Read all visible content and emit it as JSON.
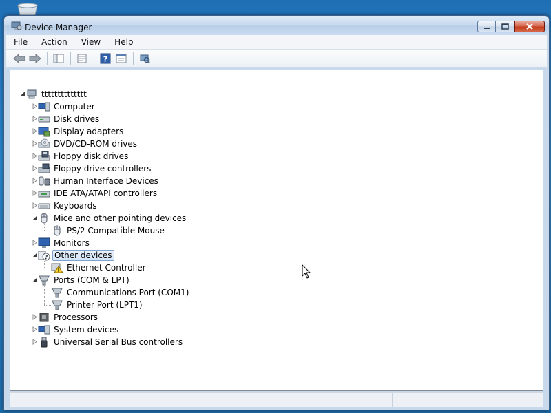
{
  "window": {
    "title": "Device Manager",
    "icon": "device-manager-icon"
  },
  "menu": [
    "File",
    "Action",
    "View",
    "Help"
  ],
  "toolbar": {
    "buttons": [
      "back-arrow-icon",
      "forward-arrow-icon",
      "show-hide-tree-icon",
      "properties-icon",
      "help-icon",
      "update-driver-icon",
      "scan-hardware-icon"
    ]
  },
  "tree": {
    "root": "tttttttttttttt",
    "nodes": [
      {
        "label": "Computer",
        "icon": "computer-icon",
        "expanded": false
      },
      {
        "label": "Disk drives",
        "icon": "disk-drive-icon",
        "expanded": false
      },
      {
        "label": "Display adapters",
        "icon": "display-adapter-icon",
        "expanded": false
      },
      {
        "label": "DVD/CD-ROM drives",
        "icon": "dvd-drive-icon",
        "expanded": false
      },
      {
        "label": "Floppy disk drives",
        "icon": "floppy-drive-icon",
        "expanded": false
      },
      {
        "label": "Floppy drive controllers",
        "icon": "floppy-controller-icon",
        "expanded": false
      },
      {
        "label": "Human Interface Devices",
        "icon": "hid-icon",
        "expanded": false
      },
      {
        "label": "IDE ATA/ATAPI controllers",
        "icon": "ide-controller-icon",
        "expanded": false
      },
      {
        "label": "Keyboards",
        "icon": "keyboard-icon",
        "expanded": false
      },
      {
        "label": "Mice and other pointing devices",
        "icon": "mouse-icon",
        "expanded": true,
        "children": [
          {
            "label": "PS/2 Compatible Mouse",
            "icon": "mouse-icon"
          }
        ]
      },
      {
        "label": "Monitors",
        "icon": "monitor-icon",
        "expanded": false
      },
      {
        "label": "Other devices",
        "icon": "unknown-device-icon",
        "expanded": true,
        "selected": true,
        "children": [
          {
            "label": "Ethernet Controller",
            "icon": "warning-device-icon"
          }
        ]
      },
      {
        "label": "Ports (COM & LPT)",
        "icon": "port-icon",
        "expanded": true,
        "children": [
          {
            "label": "Communications Port (COM1)",
            "icon": "port-icon"
          },
          {
            "label": "Printer Port (LPT1)",
            "icon": "port-icon"
          }
        ]
      },
      {
        "label": "Processors",
        "icon": "processor-icon",
        "expanded": false
      },
      {
        "label": "System devices",
        "icon": "system-device-icon",
        "expanded": false
      },
      {
        "label": "Universal Serial Bus controllers",
        "icon": "usb-icon",
        "expanded": false
      }
    ]
  },
  "colors": {
    "selection_border": "#7da2ce",
    "titlebar": "#c6d8ee",
    "close_button": "#c3401f"
  }
}
